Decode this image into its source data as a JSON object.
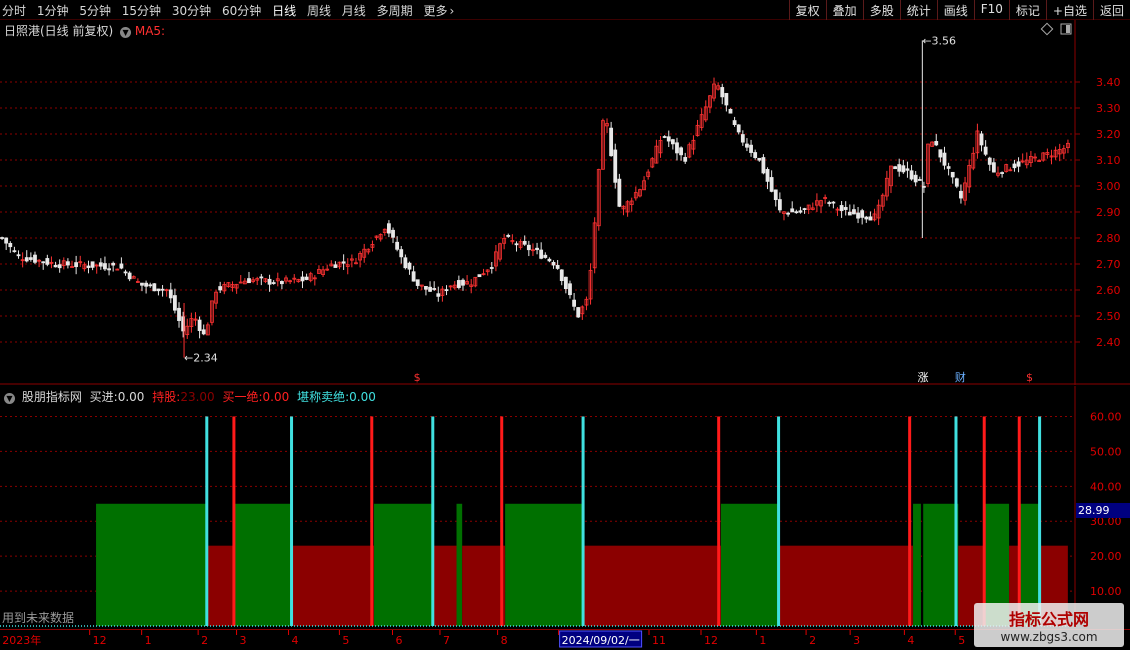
{
  "toolbar": {
    "periods": [
      "分时",
      "1分钟",
      "5分钟",
      "15分钟",
      "30分钟",
      "60分钟",
      "日线",
      "周线",
      "月线",
      "多周期",
      "更多"
    ],
    "active_period": "日线",
    "more_icon": "chevron-right-icon",
    "buttons": [
      "复权",
      "叠加",
      "多股",
      "统计",
      "画线",
      "F10",
      "标记",
      "+自选",
      "返回"
    ]
  },
  "main_panel": {
    "title": "日照港(日线 前复权)",
    "indicator": "MA5:",
    "price_ticks": [
      "3.40",
      "3.30",
      "3.20",
      "3.10",
      "3.00",
      "2.90",
      "2.80",
      "2.70",
      "2.60",
      "2.50",
      "2.40"
    ],
    "high_label": "3.56",
    "low_label": "2.34",
    "markers": [
      {
        "text": "$",
        "color": "#ff3030",
        "pos": 0.366
      },
      {
        "text": "涨",
        "color": "#ffffff",
        "pos": 0.812
      },
      {
        "text": "财",
        "color": "#6ab0ff",
        "pos": 0.845
      },
      {
        "text": "$",
        "color": "#ff3030",
        "pos": 0.908
      }
    ]
  },
  "sub_panel": {
    "name": "股朋指标网",
    "buy_label": "买进:",
    "buy_value": "0.00",
    "hold_label": "持股:",
    "hold_value": "23.00",
    "sell1_label": "买一绝:",
    "sell1_value": "0.00",
    "sell2_label": "堪称卖绝:",
    "sell2_value": "0.00",
    "ticks": [
      "60.00",
      "50.00",
      "40.00",
      "30.00",
      "20.00",
      "10.00"
    ],
    "current_value": "28.99",
    "footer_text": "用到未来数据"
  },
  "date_axis": {
    "labels": [
      "2023年",
      "12",
      "1",
      "2",
      "3",
      "4",
      "5",
      "6",
      "7",
      "8",
      "2024/09/02/一",
      "11",
      "12",
      "1",
      "2",
      "3",
      "4",
      "5"
    ]
  },
  "colors": {
    "candle_up": "#ff3232",
    "candle_down": "#e8e8e8",
    "green_bar": "#007000",
    "red_bar": "#8b0000",
    "cyan_line": "#40e0e0",
    "red_line": "#ff1a1a",
    "grid": "#8b0000",
    "axis_text": "#e00000"
  },
  "chart_data": {
    "type": "bar",
    "title": "股朋指标网",
    "ylim": [
      0,
      63
    ],
    "green_segments": [
      [
        0.085,
        0.182,
        35
      ],
      [
        0.208,
        0.257,
        35
      ],
      [
        0.331,
        0.383,
        35
      ],
      [
        0.404,
        0.409,
        35
      ],
      [
        0.447,
        0.516,
        35
      ],
      [
        0.638,
        0.689,
        35
      ],
      [
        0.808,
        0.815,
        35
      ],
      [
        0.817,
        0.848,
        35
      ],
      [
        0.872,
        0.893,
        35
      ],
      [
        0.903,
        0.92,
        35
      ]
    ],
    "red_segments": [
      [
        0.182,
        0.208,
        23
      ],
      [
        0.257,
        0.331,
        23
      ],
      [
        0.383,
        0.404,
        23
      ],
      [
        0.409,
        0.447,
        23
      ],
      [
        0.516,
        0.638,
        23
      ],
      [
        0.689,
        0.808,
        23
      ],
      [
        0.848,
        0.872,
        23
      ],
      [
        0.893,
        0.903,
        23
      ],
      [
        0.92,
        0.945,
        23
      ]
    ],
    "cyan_lines": [
      0.183,
      0.258,
      0.383,
      0.516,
      0.689,
      0.846,
      0.92
    ],
    "red_lines": [
      0.207,
      0.329,
      0.444,
      0.636,
      0.805,
      0.871,
      0.902
    ],
    "line_value": 60
  }
}
